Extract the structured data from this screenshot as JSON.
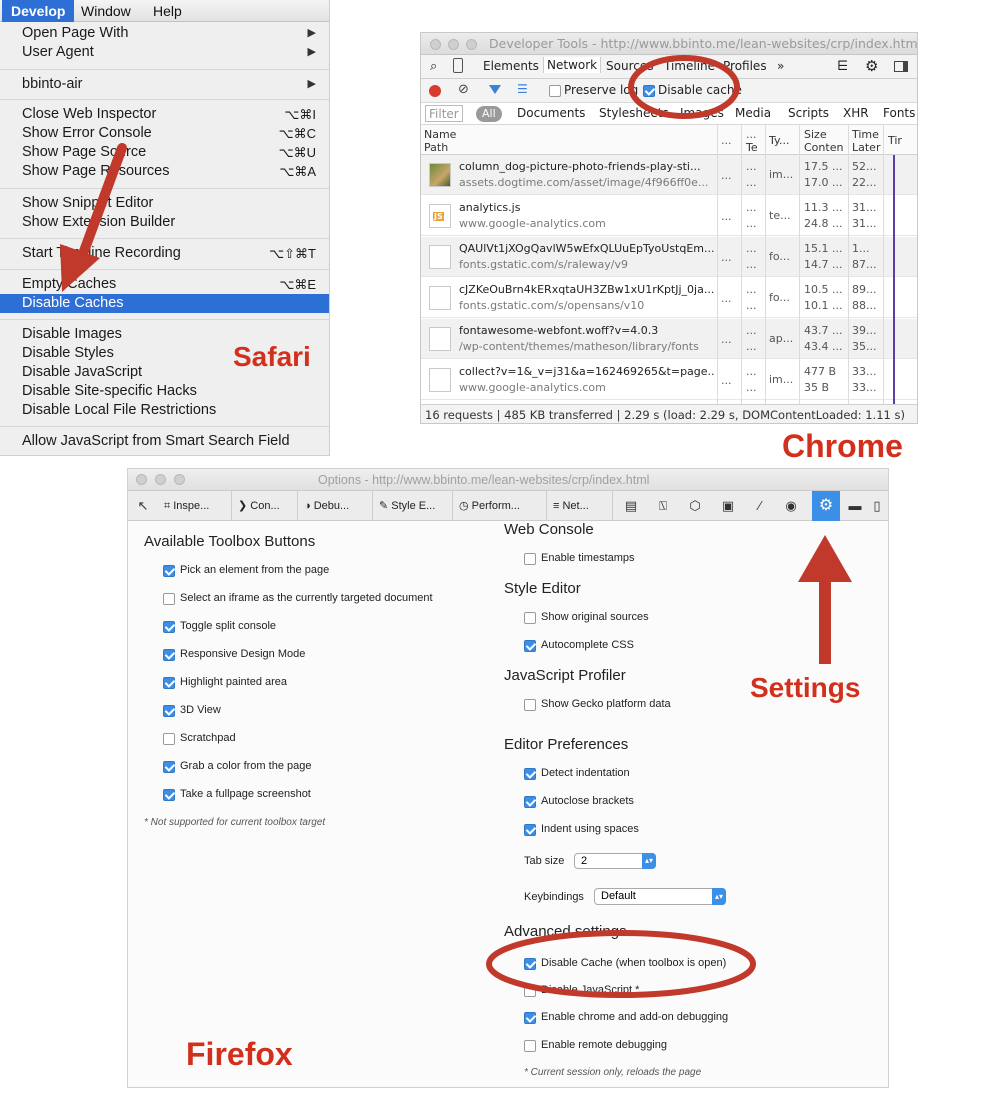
{
  "safari": {
    "menubar": [
      "Develop",
      "Window",
      "Help"
    ],
    "groups": [
      [
        {
          "label": "Open Page With",
          "submenu": true
        },
        {
          "label": "User Agent",
          "submenu": true
        }
      ],
      [
        {
          "label": "bbinto-air",
          "submenu": true
        }
      ],
      [
        {
          "label": "Close Web Inspector",
          "shortcut": "⌥⌘I"
        },
        {
          "label": "Show Error Console",
          "shortcut": "⌥⌘C"
        },
        {
          "label": "Show Page Source",
          "shortcut": "⌥⌘U"
        },
        {
          "label": "Show Page Resources",
          "shortcut": "⌥⌘A"
        }
      ],
      [
        {
          "label": "Show Snippet Editor"
        },
        {
          "label": "Show Extension Builder"
        }
      ],
      [
        {
          "label": "Start Timeline Recording",
          "shortcut": "⌥⇧⌘T"
        }
      ],
      [
        {
          "label": "Empty Caches",
          "shortcut": "⌥⌘E"
        },
        {
          "label": "Disable Caches",
          "highlighted": true
        }
      ],
      [
        {
          "label": "Disable Images"
        },
        {
          "label": "Disable Styles"
        },
        {
          "label": "Disable JavaScript"
        },
        {
          "label": "Disable Site-specific Hacks"
        },
        {
          "label": "Disable Local File Restrictions"
        }
      ],
      [
        {
          "label": "Allow JavaScript from Smart Search Field"
        }
      ]
    ],
    "label": "Safari"
  },
  "chrome": {
    "title": "Developer Tools - http://www.bbinto.me/lean-websites/crp/index.html",
    "tabs": [
      "Elements",
      "Network",
      "Sources",
      "Timeline",
      "Profiles",
      "»"
    ],
    "tools": {
      "preserve_log": "Preserve log",
      "disable_cache": "Disable cache"
    },
    "filter": {
      "placeholder": "Filter",
      "all": "All",
      "types": [
        "Documents",
        "Stylesheets",
        "Images",
        "Media",
        "Scripts",
        "XHR",
        "Fonts"
      ]
    },
    "columns": {
      "name": "Name",
      "path": "Path",
      "m1": "...",
      "m2": "...",
      "m2b": "Te",
      "type": "Ty...",
      "size": "Size",
      "size2": "Conten",
      "time": "Time",
      "time2": "Later",
      "timeline": "Tir"
    },
    "rows": [
      {
        "name": "column_dog-picture-photo-friends-play-sti...",
        "path": "assets.dogtime.com/asset/image/4f966ff0e...",
        "type": "im...",
        "size": "17.5 ...",
        "size2": "17.0 ...",
        "time": "52...",
        "time2": "22...",
        "icon": "image"
      },
      {
        "name": "analytics.js",
        "path": "www.google-analytics.com",
        "type": "te...",
        "size": "11.3 ...",
        "size2": "24.8 ...",
        "time": "31...",
        "time2": "31...",
        "icon": "js"
      },
      {
        "name": "QAUlVt1jXOgQavlW5wEfxQLUuEpTyoUstqEm...",
        "path": "fonts.gstatic.com/s/raleway/v9",
        "type": "fo...",
        "size": "15.1 ...",
        "size2": "14.7 ...",
        "time": "1...",
        "time2": "87...",
        "icon": "file"
      },
      {
        "name": "cJZKeOuBrn4kERxqtaUH3ZBw1xU1rKptJj_0ja...",
        "path": "fonts.gstatic.com/s/opensans/v10",
        "type": "fo...",
        "size": "10.5 ...",
        "size2": "10.1 ...",
        "time": "89...",
        "time2": "88...",
        "icon": "file"
      },
      {
        "name": "fontawesome-webfont.woff?v=4.0.3",
        "path": "/wp-content/themes/matheson/library/fonts",
        "type": "ap...",
        "size": "43.7 ...",
        "size2": "43.4 ...",
        "time": "39...",
        "time2": "35...",
        "icon": "file"
      },
      {
        "name": "collect?v=1&_v=j31&a=162469265&t=page...",
        "path": "www.google-analytics.com",
        "type": "im...",
        "size": "477 B",
        "size2": "35 B",
        "time": "33...",
        "time2": "33...",
        "icon": "file"
      }
    ],
    "status": "16 requests | 485 KB transferred | 2.29 s (load: 2.29 s, DOMContentLoaded: 1.11 s)",
    "label": "Chrome"
  },
  "firefox": {
    "title": "Options - http://www.bbinto.me/lean-websites/crp/index.html",
    "tabs": [
      "Inspe...",
      "Con...",
      "Debu...",
      "Style E...",
      "Perform...",
      "Net..."
    ],
    "left_heading": "Available Toolbox Buttons",
    "left_items": [
      {
        "label": "Pick an element from the page",
        "checked": true
      },
      {
        "label": "Select an iframe as the currently targeted document",
        "checked": false
      },
      {
        "label": "Toggle split console",
        "checked": true
      },
      {
        "label": "Responsive Design Mode",
        "checked": true
      },
      {
        "label": "Highlight painted area",
        "checked": true
      },
      {
        "label": "3D View",
        "checked": true
      },
      {
        "label": "Scratchpad",
        "checked": false
      },
      {
        "label": "Grab a color from the page",
        "checked": true
      },
      {
        "label": "Take a fullpage screenshot",
        "checked": true
      }
    ],
    "left_note": "* Not supported for current toolbox target",
    "web_console": {
      "heading": "Web Console",
      "items": [
        {
          "label": "Enable timestamps",
          "checked": false
        }
      ]
    },
    "style_editor": {
      "heading": "Style Editor",
      "items": [
        {
          "label": "Show original sources",
          "checked": false
        },
        {
          "label": "Autocomplete CSS",
          "checked": true
        }
      ]
    },
    "js_profiler": {
      "heading": "JavaScript Profiler",
      "items": [
        {
          "label": "Show Gecko platform data",
          "checked": false
        }
      ]
    },
    "editor_prefs": {
      "heading": "Editor Preferences",
      "items": [
        {
          "label": "Detect indentation",
          "checked": true
        },
        {
          "label": "Autoclose brackets",
          "checked": true
        },
        {
          "label": "Indent using spaces",
          "checked": true
        }
      ]
    },
    "tab_size": {
      "label": "Tab size",
      "value": "2"
    },
    "keybindings": {
      "label": "Keybindings",
      "value": "Default"
    },
    "advanced": {
      "heading": "Advanced settings",
      "items": [
        {
          "label": "Disable Cache (when toolbox is open)",
          "checked": true
        },
        {
          "label": "Disable JavaScript *",
          "checked": false
        },
        {
          "label": "Enable chrome and add-on debugging",
          "checked": true
        },
        {
          "label": "Enable remote debugging",
          "checked": false
        }
      ]
    },
    "note": "* Current session only, reloads the page",
    "label": "Firefox",
    "settings_label": "Settings"
  },
  "colors": {
    "annotation": "#c0392b",
    "label_red": "#d2301c",
    "highlight": "#2e6fd6",
    "checkbox": "#3b8fe6"
  }
}
